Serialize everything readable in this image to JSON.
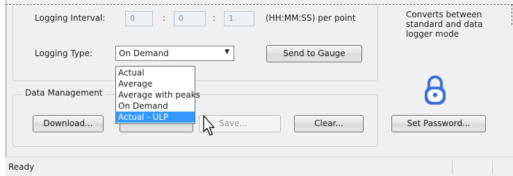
{
  "logging": {
    "interval_label": "Logging Interval:",
    "hours": "0",
    "minutes": "0",
    "seconds": "1",
    "separator": ":",
    "unit_label": "(HH:MM:SS) per point",
    "type_label": "Logging Type:",
    "type_value": "On Demand",
    "type_options": [
      "Actual",
      "Average",
      "Average with peaks",
      "On Demand",
      "Actual - ULP"
    ],
    "hovered_option": "Actual - ULP",
    "send_button": "Send to Gauge"
  },
  "data_management": {
    "title": "Data Management",
    "download_button": "Download...",
    "hidden_button": "",
    "save_button": "Save...",
    "clear_button": "Clear..."
  },
  "security": {
    "description": "Converts between standard and data logger mode",
    "set_password_button": "Set Password...",
    "lock_color": "#3a6fd8"
  },
  "status_bar": {
    "text": "Ready"
  },
  "icons": [
    "chevron-down-icon",
    "lock-icon",
    "mouse-cursor-icon"
  ]
}
